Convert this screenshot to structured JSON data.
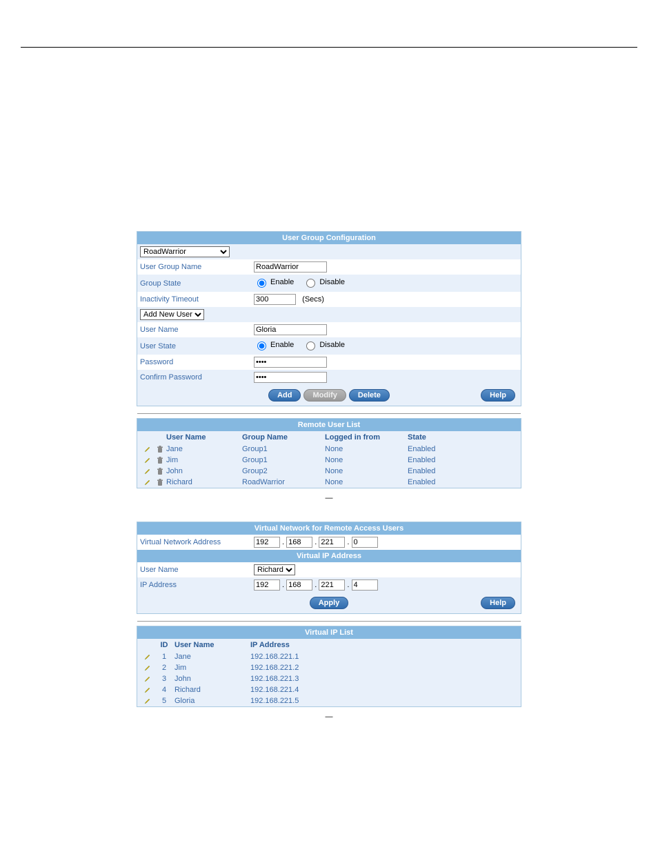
{
  "panel1": {
    "title": "User Group Configuration",
    "group_select": "RoadWarrior",
    "group_name_label": "User Group Name",
    "group_name_value": "RoadWarrior",
    "group_state_label": "Group State",
    "enable_label": "Enable",
    "disable_label": "Disable",
    "inactivity_label": "Inactivity Timeout",
    "inactivity_value": "300",
    "inactivity_unit": "(Secs)",
    "add_user_select": "Add New User",
    "user_name_label": "User Name",
    "user_name_value": "Gloria",
    "user_state_label": "User State",
    "password_label": "Password",
    "password_value": "****",
    "confirm_label": "Confirm Password",
    "confirm_value": "****",
    "btn_add": "Add",
    "btn_modify": "Modify",
    "btn_delete": "Delete",
    "btn_help": "Help"
  },
  "list1": {
    "title": "Remote User List",
    "h_user": "User Name",
    "h_group": "Group Name",
    "h_log": "Logged in from",
    "h_state": "State",
    "rows": [
      {
        "user": "Jane",
        "group": "Group1",
        "log": "None",
        "state": "Enabled"
      },
      {
        "user": "Jim",
        "group": "Group1",
        "log": "None",
        "state": "Enabled"
      },
      {
        "user": "John",
        "group": "Group2",
        "log": "None",
        "state": "Enabled"
      },
      {
        "user": "Richard",
        "group": "RoadWarrior",
        "log": "None",
        "state": "Enabled"
      }
    ]
  },
  "caption1": "—",
  "panel2": {
    "title": "Virtual Network for Remote Access Users",
    "vna_label": "Virtual Network Address",
    "vna": [
      "192",
      "168",
      "221",
      "0"
    ],
    "subtitle": "Virtual IP Address",
    "user_label": "User Name",
    "user_select": "Richard",
    "ip_label": "IP Address",
    "ip": [
      "192",
      "168",
      "221",
      "4"
    ],
    "btn_apply": "Apply",
    "btn_help": "Help"
  },
  "list2": {
    "title": "Virtual IP List",
    "h_id": "ID",
    "h_user": "User Name",
    "h_ip": "IP Address",
    "rows": [
      {
        "id": "1",
        "user": "Jane",
        "ip": "192.168.221.1"
      },
      {
        "id": "2",
        "user": "Jim",
        "ip": "192.168.221.2"
      },
      {
        "id": "3",
        "user": "John",
        "ip": "192.168.221.3"
      },
      {
        "id": "4",
        "user": "Richard",
        "ip": "192.168.221.4"
      },
      {
        "id": "5",
        "user": "Gloria",
        "ip": "192.168.221.5"
      }
    ]
  },
  "caption2": "—"
}
